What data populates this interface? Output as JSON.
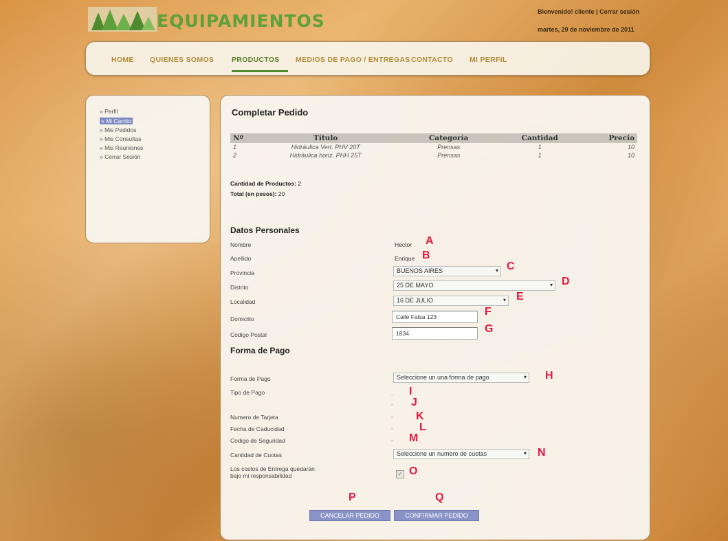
{
  "header": {
    "logo_text": "EQUIPAMIENTOS",
    "welcome": "Bienvenido! cliente",
    "separator": "|",
    "logout_link": "Cerrar sesión",
    "date": "martes, 29 de noviembre de 2011"
  },
  "nav": {
    "items": [
      {
        "label": "HOME"
      },
      {
        "label": "QUIENES SOMOS"
      },
      {
        "label": "PRODUCTOS"
      },
      {
        "label": "MEDIOS DE PAGO / ENTREGAS"
      },
      {
        "label": "CONTACTO"
      },
      {
        "label": "MI PERFIL"
      }
    ],
    "active": "PRODUCTOS"
  },
  "sidebar": {
    "items": [
      {
        "label": "» Perfil"
      },
      {
        "label": "» Mi Carrito"
      },
      {
        "label": "» Mis Pedidos"
      },
      {
        "label": "» Mis Consultas"
      },
      {
        "label": "» Mis Reuniones"
      },
      {
        "label": "» Cerrar Sesión"
      }
    ],
    "active_index": 1
  },
  "main": {
    "title": "Completar Pedido",
    "table": {
      "headers": [
        "Nº",
        "Título",
        "Categoría",
        "Cantidad",
        "Precio"
      ],
      "rows": [
        [
          "1",
          "Hidráulica Vert. PHV 20T",
          "Prensas",
          "1",
          "10"
        ],
        [
          "2",
          "Hidráulica horiz. PHH 25T",
          "Prensas",
          "1",
          "10"
        ]
      ]
    },
    "summary": {
      "count_label": "Cantidad de Productos:",
      "count_value": "2",
      "total_label": "Total (en pesos):",
      "total_value": "20"
    },
    "personal": {
      "title": "Datos Personales",
      "nombre_label": "Nombre",
      "nombre_value": "Hector",
      "apellido_label": "Apellido",
      "apellido_value": "Enrique",
      "provincia_label": "Provincia",
      "provincia_value": "BUENOS AIRES",
      "distrito_label": "Distrito",
      "distrito_value": "25 DE MAYO",
      "localidad_label": "Localidad",
      "localidad_value": "16 DE JULIO",
      "domicilio_label": "Domicilio",
      "domicilio_value": "Calle Falsa 123",
      "cp_label": "Codigo Postal",
      "cp_value": "1834"
    },
    "payment": {
      "title": "Forma de Pago",
      "forma_label": "Forma de Pago",
      "forma_value": "Seleccione un una forma de pago",
      "tipo_label": "Tipo de Pago",
      "numero_label": "Numero de Tarjeta",
      "fecha_label": "Fecha de Caducidad",
      "codigo_label": "Codigo de Seguridad",
      "cuotas_label": "Cantidad de Cuotas",
      "cuotas_value": "Seleccione un numero de cuotas",
      "costos_label_1": "Los costos de Entrega quedarán",
      "costos_label_2": "bajo mi responsabilidad",
      "dash": "-"
    },
    "buttons": {
      "cancel": "CANCELAR PEDIDO",
      "confirm": "CONFIRMAR PEDIDO"
    },
    "markers": {
      "A": "A",
      "B": "B",
      "C": "C",
      "D": "D",
      "E": "E",
      "F": "F",
      "G": "G",
      "H": "H",
      "I": "I",
      "J": "J",
      "K": "K",
      "L": "L",
      "M": "M",
      "N": "N",
      "O": "O",
      "P": "P",
      "Q": "Q"
    }
  },
  "colors": {
    "nav_active": "#5b7f2a",
    "nav_text": "#b08c3a",
    "button_bg": "#8a93c7",
    "marker": "#e3173f",
    "logo": "#5fa03a"
  }
}
